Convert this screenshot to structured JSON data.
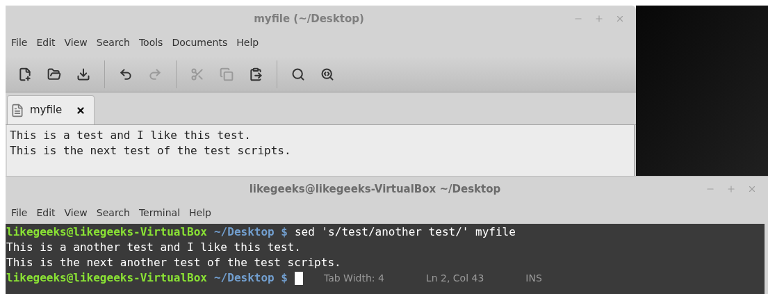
{
  "editor": {
    "title": "myfile (~/Desktop)",
    "menu": [
      "File",
      "Edit",
      "View",
      "Search",
      "Tools",
      "Documents",
      "Help"
    ],
    "toolbar": [
      [
        {
          "disabled": false
        },
        {
          "disabled": false
        },
        {
          "disabled": false
        }
      ],
      [
        {
          "disabled": false
        },
        {
          "disabled": true
        }
      ],
      [
        {
          "disabled": true
        },
        {
          "disabled": true
        },
        {
          "disabled": false
        }
      ],
      [
        {
          "disabled": false
        },
        {
          "disabled": false
        }
      ]
    ],
    "tabs": [
      {
        "label": "myfile",
        "selected": true
      }
    ],
    "lines": [
      "This is a test and I like this test.",
      "This is the next test of the test scripts."
    ],
    "status": [
      "Tab Width: 4",
      "Ln 2, Col 43",
      "INS"
    ]
  },
  "terminal": {
    "title": "likegeeks@likegeeks-VirtualBox ~/Desktop",
    "menu": [
      "File",
      "Edit",
      "View",
      "Search",
      "Terminal",
      "Help"
    ],
    "lines": [
      {
        "kind": "prompt",
        "user": "likegeeks@likegeeks-VirtualBox",
        "path": "~/Desktop $",
        "command": "sed 's/test/another test/' myfile"
      },
      {
        "kind": "output",
        "text": "This is a another test and I like this test."
      },
      {
        "kind": "output",
        "text": "This is the next another test of the test scripts."
      },
      {
        "kind": "prompt",
        "user": "likegeeks@likegeeks-VirtualBox",
        "path": "~/Desktop $",
        "cursor": true
      }
    ]
  }
}
